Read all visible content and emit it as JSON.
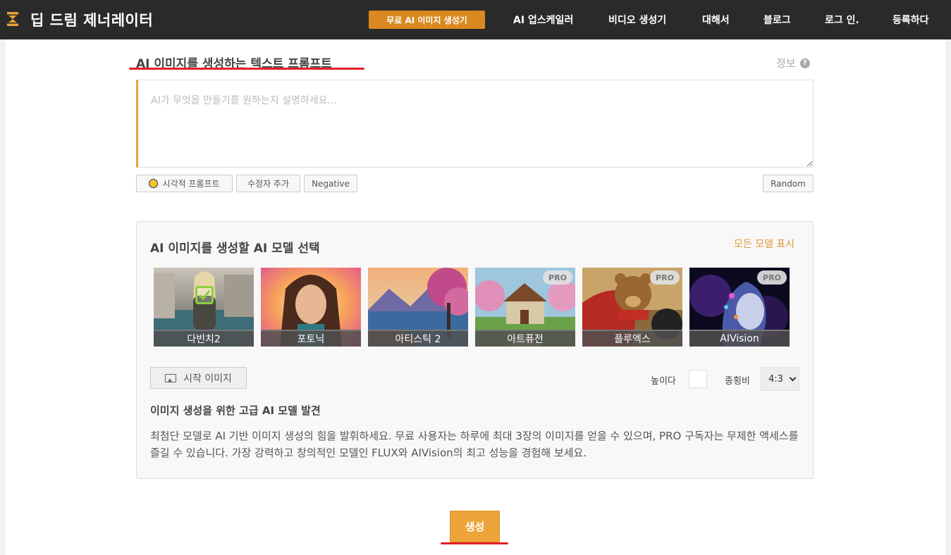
{
  "header": {
    "brand": "딥 드림 제너레이터",
    "cta_label": "무료 AI 이미지 생성기",
    "nav": [
      "AI 업스케일러",
      "비디오 생성기",
      "대해서",
      "블로그",
      "로그 인.",
      "등록하다"
    ]
  },
  "prompt": {
    "title": "AI 이미지를 생성하는 텍스트 프롬프트",
    "info_label": "정보",
    "info_icon": "question-circle-icon",
    "placeholder": "AI가 무엇을 만들기를 원하는지 설명하세요...",
    "buttons": {
      "visual": "시각적 프롬프트",
      "modifier": "수정자 추가",
      "negative": "Negative",
      "random": "Random"
    }
  },
  "models": {
    "title": "AI 이미지를 생성할 AI 모델 선택",
    "show_all": "모든 모델 표시",
    "pro_badge": "PRO",
    "items": [
      {
        "name": "다빈치2",
        "selected": true,
        "pro": false
      },
      {
        "name": "포토닉",
        "selected": false,
        "pro": false
      },
      {
        "name": "아티스틱 2",
        "selected": false,
        "pro": false
      },
      {
        "name": "아트퓨전",
        "selected": false,
        "pro": true
      },
      {
        "name": "플루엑스",
        "selected": false,
        "pro": true
      },
      {
        "name": "AIVision",
        "selected": false,
        "pro": true
      }
    ],
    "start_image_label": "시작 이미지",
    "height_label": "높이다",
    "ratio_label": "종횡비",
    "ratio_value": "4:3",
    "adv_title": "이미지 생성을 위한 고급 AI 모델 발견",
    "adv_desc": "최첨단 모델로 AI 기반 이미지 생성의 힘을 발휘하세요. 무료 사용자는 하루에 최대 3장의 이미지를 얻을 수 있으며, PRO 구독자는 무제한 액세스를 즐길 수 있습니다. 가장 강력하고 창의적인 모델인 FLUX와 AIVision의 최고 성능을 경험해 보세요."
  },
  "generate_label": "생성",
  "colors": {
    "accent": "#eda43a",
    "topbar": "#2a2a2a",
    "underline": "#e0202a"
  }
}
